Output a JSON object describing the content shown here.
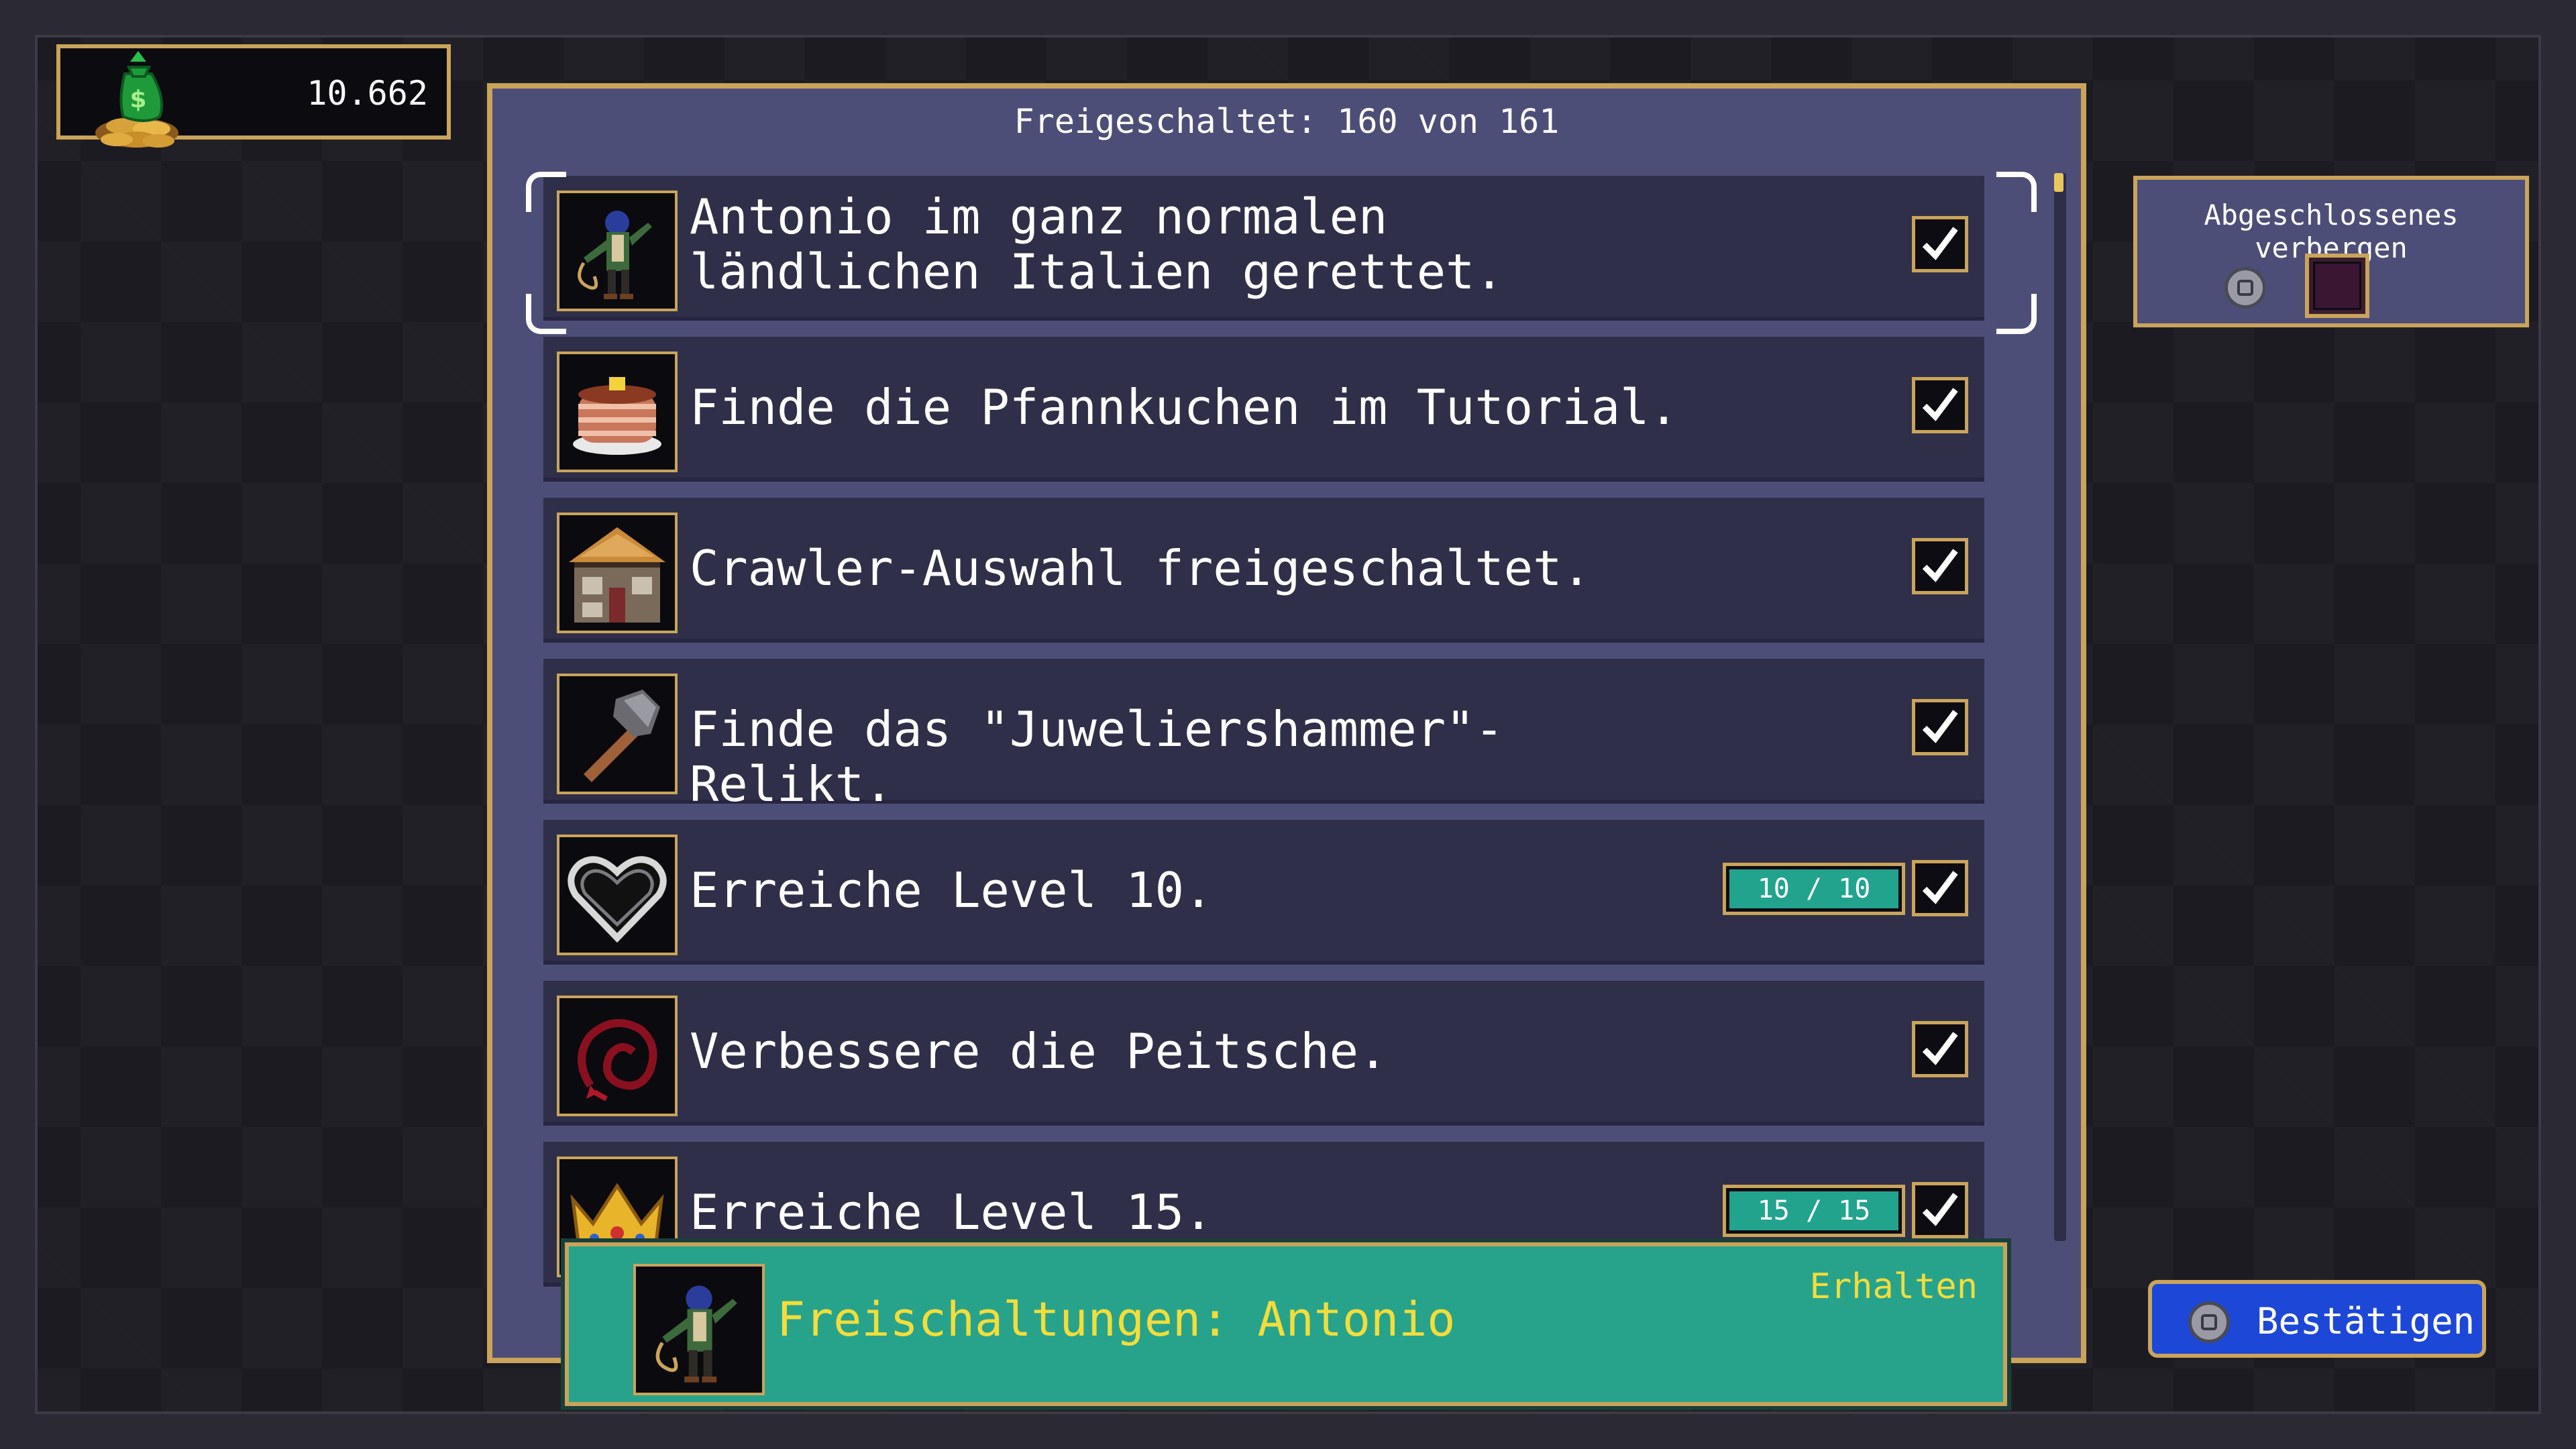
{
  "money": {
    "value": "10.662",
    "icon": "money-bag-with-coins-icon"
  },
  "panel": {
    "header": "Freigeschaltet: 160 von 161"
  },
  "achievements": [
    {
      "text": "Antonio im ganz normalen ländlichen Italien gerettet.",
      "icon": "antonio-character-icon",
      "completed": true,
      "selected": true
    },
    {
      "text": "Finde die Pfannkuchen im Tutorial.",
      "icon": "pancakes-icon",
      "completed": true
    },
    {
      "text": "Crawler-Auswahl freigeschaltet.",
      "icon": "house-icon",
      "completed": true
    },
    {
      "text": "Finde das \"Juweliershammer\"-Relikt.",
      "icon": "hammer-icon",
      "completed": true
    },
    {
      "text": "Erreiche Level 10.",
      "icon": "heart-outline-icon",
      "completed": true,
      "progress": {
        "label": "10 / 10",
        "value": 10,
        "max": 10
      }
    },
    {
      "text": "Verbessere die Peitsche.",
      "icon": "whip-icon",
      "completed": true
    },
    {
      "text": "Erreiche Level 15.",
      "icon": "crown-icon",
      "completed": true,
      "progress": {
        "label": "15 / 15",
        "value": 15,
        "max": 15
      }
    }
  ],
  "reward": {
    "title": "Freischaltungen: Antonio",
    "status": "Erhalten",
    "icon": "antonio-character-icon"
  },
  "hide_completed": {
    "label": "Abgeschlossenes verbergen",
    "checked": false,
    "button_icon": "controller-button-icon"
  },
  "confirm": {
    "label": "Bestätigen",
    "button_icon": "controller-button-icon"
  },
  "colors": {
    "gold_border": "#c9a45a",
    "panel": "#4d4e78",
    "row": "#2f2f49",
    "reward": "#27a38c",
    "reward_text": "#f3dd3a",
    "confirm": "#1d47d6"
  }
}
